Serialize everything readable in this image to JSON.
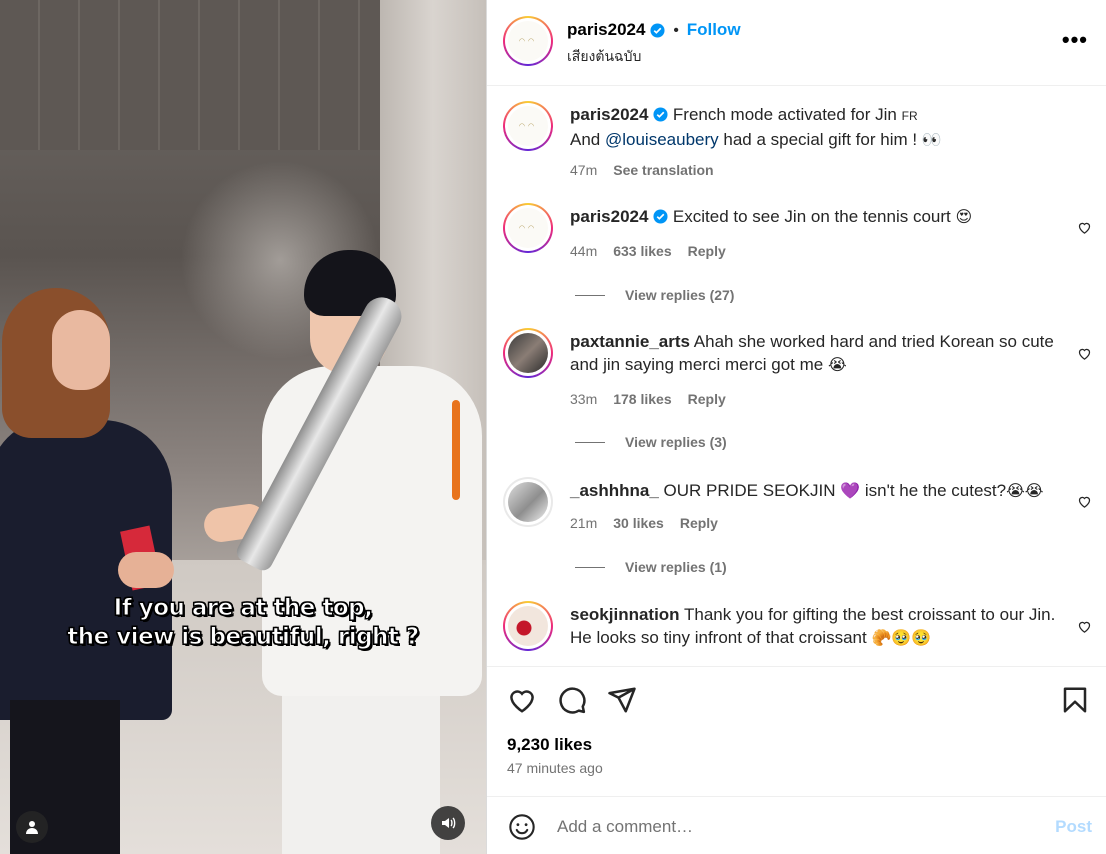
{
  "video": {
    "subtitle_line1": "If you are at the top,",
    "subtitle_line2": "the view is beautiful, right ?"
  },
  "header": {
    "username": "paris2024",
    "follow_label": "Follow",
    "audio_label": "เสียงต้นฉบับ",
    "more_label": "•••"
  },
  "caption": {
    "username": "paris2024",
    "text_line1": "French mode activated for Jin",
    "flag": "FR",
    "text_line2_prefix": "And",
    "mention": "@louiseaubery",
    "text_line2_suffix": "had a special gift for him !",
    "emoji": "👀",
    "time": "47m",
    "translate_label": "See translation"
  },
  "comments": [
    {
      "username": "paris2024",
      "text": "Excited to see Jin on the tennis court",
      "emoji": "😍",
      "time": "44m",
      "likes": "633 likes",
      "reply_label": "Reply",
      "replies": "View replies (27)"
    },
    {
      "username": "paxtannie_arts",
      "text": "Ahah she worked hard and tried Korean so cute and jin saying merci merci got me",
      "emoji": "😭",
      "time": "33m",
      "likes": "178 likes",
      "reply_label": "Reply",
      "replies": "View replies (3)"
    },
    {
      "username": "_ashhhna_",
      "text": "OUR PRIDE SEOKJIN",
      "emoji_mid": "💜",
      "text2": "isn't he the cutest?",
      "emoji": "😭😭",
      "time": "21m",
      "likes": "30 likes",
      "reply_label": "Reply",
      "replies": "View replies (1)"
    },
    {
      "username": "seokjinnation",
      "text": "Thank you for gifting the best croissant to our Jin. He looks so tiny infront of that croissant",
      "emoji": "🥐🥹🥹"
    }
  ],
  "footer": {
    "likes": "9,230 likes",
    "time_ago": "47 minutes ago",
    "comment_placeholder": "Add a comment…",
    "post_label": "Post"
  },
  "colors": {
    "accent": "#0095f6",
    "muted": "#737373",
    "post_disabled": "#b3dbff"
  }
}
